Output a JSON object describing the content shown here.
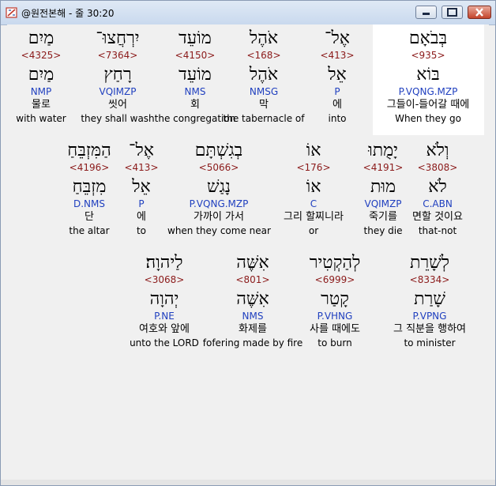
{
  "window": {
    "title": "@원전본해 - 줄 30:20",
    "icon": "book-icon"
  },
  "rows": [
    [
      {
        "hebrew": "בְּבֹאָם",
        "strongs": "<935>",
        "lemma": "בּוֹא",
        "morph": "P.VQNG.MZP",
        "korean": "그들이-들어갈 때에",
        "english": "When they go",
        "highlighted": true
      },
      {
        "hebrew": "אֶל־",
        "strongs": "<413>",
        "lemma": "אֵל",
        "morph": "P",
        "korean": "에",
        "english": "into"
      },
      {
        "hebrew": "אֹהֶל",
        "strongs": "<168>",
        "lemma": "אֹהֶל",
        "morph": "NMSG",
        "korean": "막",
        "english": "the tabernacle of"
      },
      {
        "hebrew": "מוֹעֵד",
        "strongs": "<4150>",
        "lemma": "מוֹעֵד",
        "morph": "NMS",
        "korean": "회",
        "english": "the congregation"
      },
      {
        "hebrew": "יִרְחֲצוּ־",
        "strongs": "<7364>",
        "lemma": "רָחַץ",
        "morph": "VQIMZP",
        "korean": "씻어",
        "english": "they shall wash"
      },
      {
        "hebrew": "מַיִם",
        "strongs": "<4325>",
        "lemma": "מַיִם",
        "morph": "NMP",
        "korean": "물로",
        "english": "with water"
      }
    ],
    [
      {
        "hebrew": "וְלֹא",
        "strongs": "<3808>",
        "lemma": "לֹא",
        "morph": "C.ABN",
        "korean": "면할 것이요",
        "english": "that-not"
      },
      {
        "hebrew": "יָמֻתוּ",
        "strongs": "<4191>",
        "lemma": "מוּת",
        "morph": "VQIMZP",
        "korean": "죽기를",
        "english": "they die"
      },
      {
        "hebrew": "אוֹ",
        "strongs": "<176>",
        "lemma": "אוֹ",
        "morph": "C",
        "korean": "그리 할찌니라",
        "english": "or"
      },
      {
        "hebrew": "בְגִשְׁתָּם",
        "strongs": "<5066>",
        "lemma": "נָגַשׁ",
        "morph": "P.VQNG.MZP",
        "korean": "가까이 가서",
        "english": "when they come near"
      },
      {
        "hebrew": "אֶל־",
        "strongs": "<413>",
        "lemma": "אֵל",
        "morph": "P",
        "korean": "에",
        "english": "to"
      },
      {
        "hebrew": "הַמִּזְבֵּחַ",
        "strongs": "<4196>",
        "lemma": "מִזְבֵּחַ",
        "morph": "D.NMS",
        "korean": "단",
        "english": "the altar"
      }
    ],
    [
      {
        "hebrew": "לְשָׁרֵת",
        "strongs": "<8334>",
        "lemma": "שָׁרַת",
        "morph": "P.VPNG",
        "korean": "그 직분을 행하여",
        "english": "to minister"
      },
      {
        "hebrew": "לְהַקְטִיר",
        "strongs": "<6999>",
        "lemma": "קָטַר",
        "morph": "P.VHNG",
        "korean": "사를 때에도",
        "english": "to burn"
      },
      {
        "hebrew": "אִשֶּׁה",
        "strongs": "<801>",
        "lemma": "אִשֶּׁה",
        "morph": "NMS",
        "korean": "화제를",
        "english": "fofering made by fire"
      },
      {
        "hebrew": "לַיהוָה׃",
        "strongs": "<3068>",
        "lemma": "יְהוָה",
        "morph": "P.NE",
        "korean": "여호와 앞에",
        "english": "unto the LORD"
      }
    ]
  ]
}
